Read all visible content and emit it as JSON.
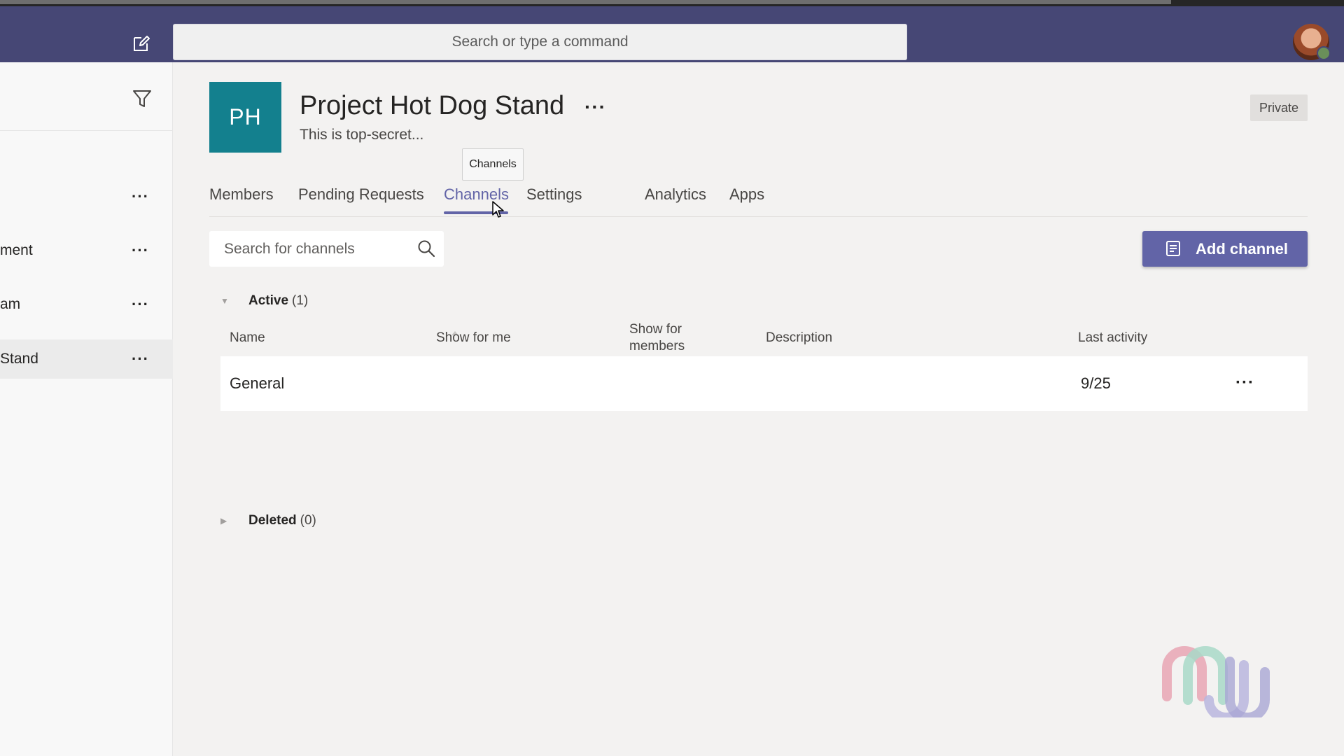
{
  "app": {
    "search_placeholder": "Search or type a command"
  },
  "sidebar": {
    "items": [
      {
        "label": "",
        "more": "···"
      },
      {
        "label": "ment",
        "more": "···"
      },
      {
        "label": "am",
        "more": "···"
      },
      {
        "label": "Stand",
        "more": "···",
        "selected": true
      }
    ]
  },
  "team": {
    "initials": "PH",
    "name": "Project Hot Dog Stand",
    "more": "···",
    "description": "This is top-secret...",
    "privacy": "Private",
    "tile_color": "#13808e"
  },
  "tooltip": "Channels",
  "tabs": [
    "Members",
    "Pending Requests",
    "Channels",
    "Settings",
    "Analytics",
    "Apps"
  ],
  "active_tab": "Channels",
  "channels": {
    "search_placeholder": "Search for channels",
    "add_label": "Add channel",
    "active_group": {
      "name": "Active",
      "count": "(1)"
    },
    "deleted_group": {
      "name": "Deleted",
      "count": "(0)"
    },
    "columns": {
      "name": "Name",
      "show_for_me": "Show for me",
      "show_for_members": "Show for members",
      "description": "Description",
      "last_activity": "Last activity"
    },
    "rows": [
      {
        "name": "General",
        "last_activity": "9/25",
        "more": "···"
      }
    ]
  },
  "colors": {
    "accent": "#6264a7",
    "appbar": "#464775"
  }
}
